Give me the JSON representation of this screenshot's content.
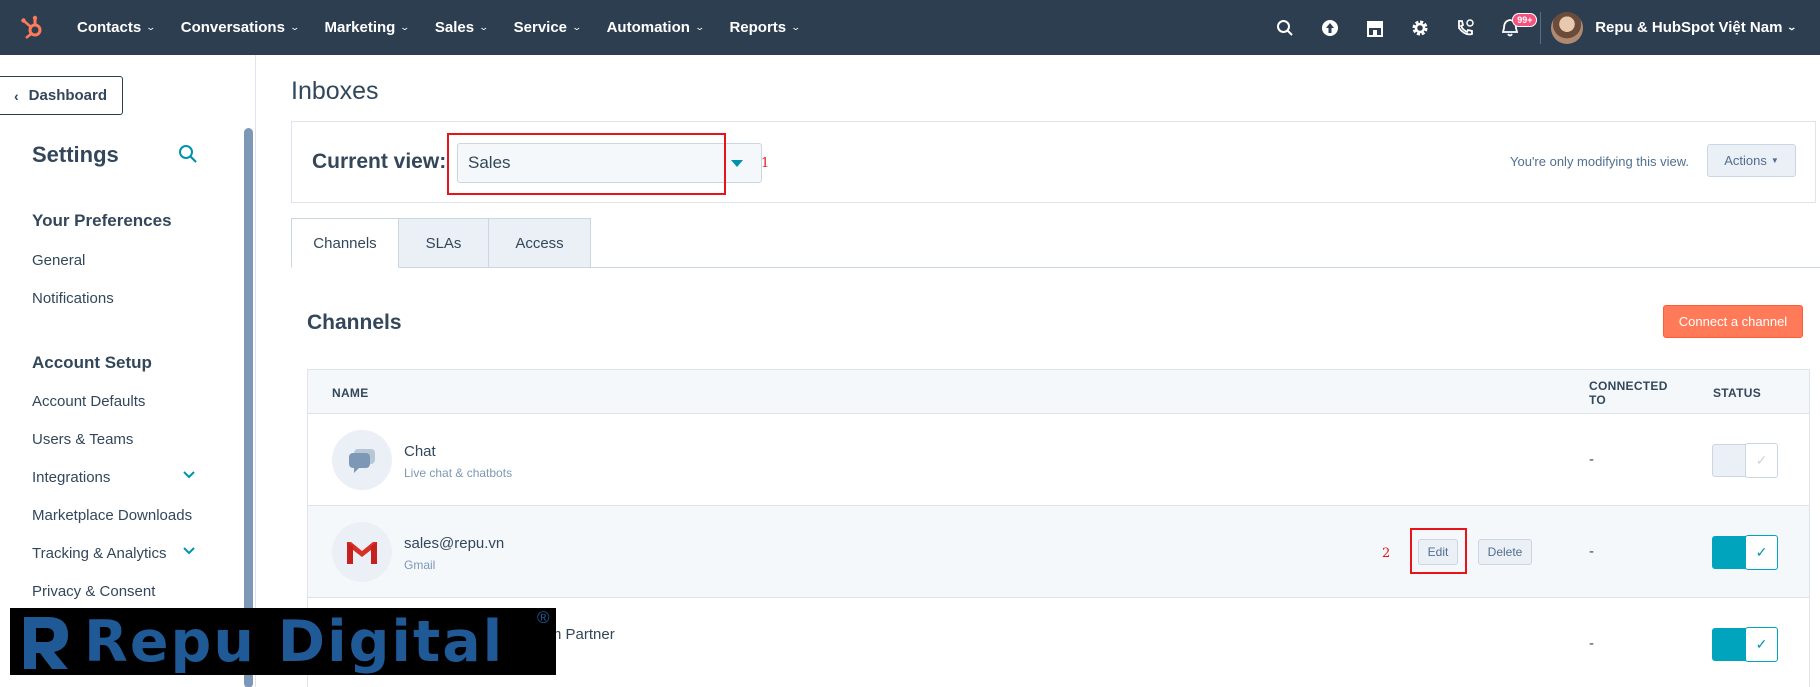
{
  "topnav": {
    "items": [
      "Contacts",
      "Conversations",
      "Marketing",
      "Sales",
      "Service",
      "Automation",
      "Reports"
    ],
    "notification_badge": "99+",
    "account_name": "Repu & HubSpot Việt Nam"
  },
  "sidebar": {
    "dashboard_label": "Dashboard",
    "title": "Settings",
    "sections": [
      {
        "label": "Your Preferences",
        "items": [
          "General",
          "Notifications"
        ]
      },
      {
        "label": "Account Setup",
        "items": [
          "Account Defaults",
          "Users & Teams",
          "Integrations",
          "Marketplace Downloads",
          "Tracking & Analytics",
          "Privacy & Consent"
        ]
      }
    ]
  },
  "main": {
    "page_title": "Inboxes",
    "current_view_label": "Current view:",
    "current_view_value": "Sales",
    "annotation_1": "1",
    "annotation_2": "2",
    "modify_note": "You're only modifying this view.",
    "actions_label": "Actions",
    "tabs": [
      "Channels",
      "SLAs",
      "Access"
    ],
    "section_title": "Channels",
    "connect_label": "Connect a channel",
    "table": {
      "headers": {
        "name": "NAME",
        "connected_to": "CONNECTED TO",
        "status": "STATUS"
      },
      "rows": [
        {
          "name": "Chat",
          "sub": "Live chat & chatbots",
          "connected": "-",
          "status_on": false
        },
        {
          "name": "sales@repu.vn",
          "sub": "Gmail",
          "connected": "-",
          "status_on": true,
          "edit_label": "Edit",
          "delete_label": "Delete"
        },
        {
          "name": "tnam Partner",
          "sub": "",
          "connected": "-",
          "status_on": true
        }
      ]
    }
  },
  "watermark": {
    "text": "Repu Digital",
    "reg": "®"
  },
  "colors": {
    "nav_bg": "#2d3e50",
    "accent": "#00a4bd",
    "cta": "#ff7a59",
    "annotation": "#e8141b"
  }
}
